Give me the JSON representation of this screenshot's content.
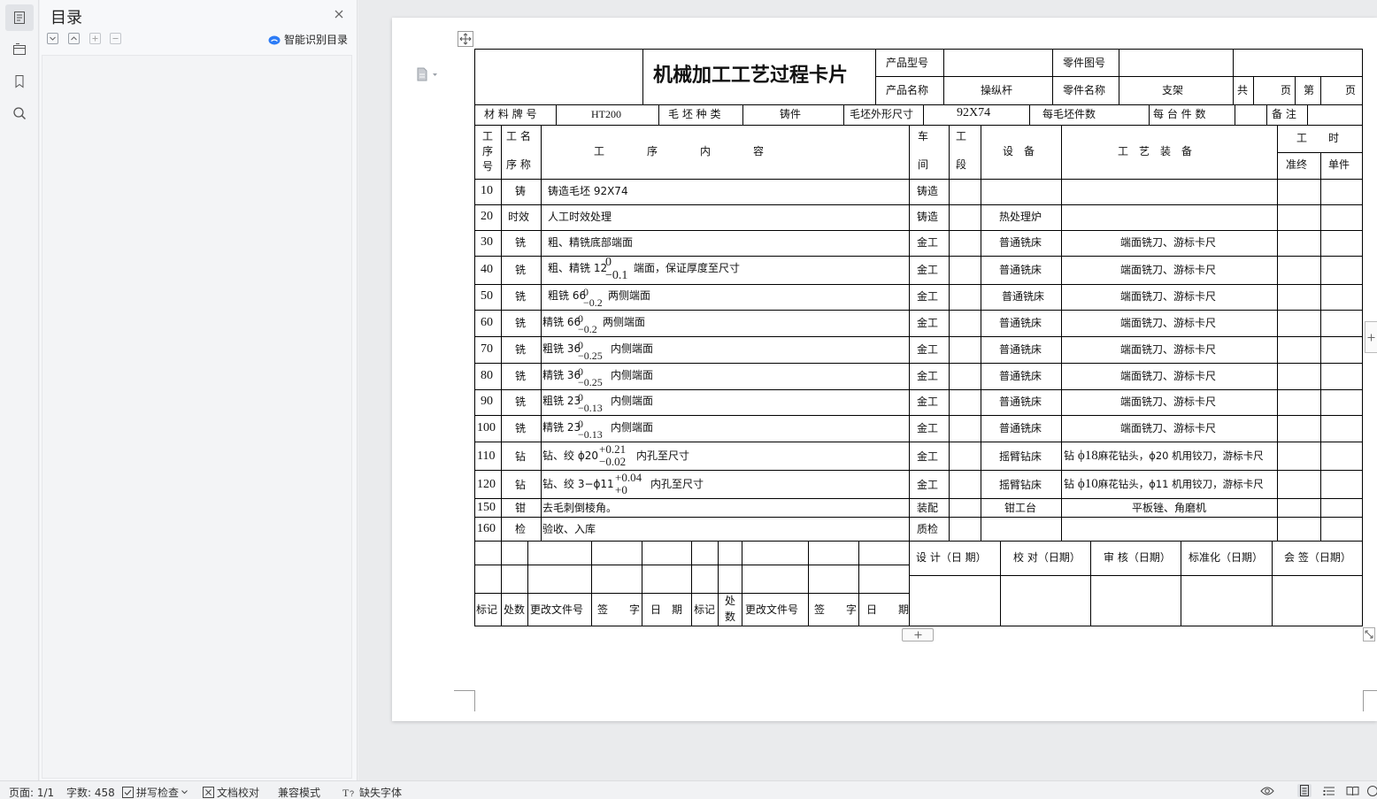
{
  "toc": {
    "title": "目录",
    "smart_label": "智能识别目录"
  },
  "card": {
    "title": "机械加工工艺过程卡片",
    "product_type_label": "产品型号",
    "part_drawing_label": "零件图号",
    "product_name_label": "产品名称",
    "product_name_value": "操纵杆",
    "part_name_label": "零件名称",
    "part_name_value": "支架",
    "total_label": "共",
    "page_label": "页",
    "sheet_label": "第",
    "page_label2": "页",
    "material_label": "材 料 牌 号",
    "material_value": "HT200",
    "blank_type_label": "毛 坯 种 类",
    "blank_type_value": "铸件",
    "blank_size_label": "毛坯外形尺寸",
    "blank_size_value": "92X74",
    "per_blank_label": "每毛坯件数",
    "per_unit_label": "每 台 件 数",
    "remark_label": "备 注",
    "col_no": [
      "工",
      "序",
      "号"
    ],
    "col_name": [
      "工 名",
      "序 称"
    ],
    "col_content": "工　　　　序　　　　内　　　　容",
    "col_workshop": [
      "车",
      "间"
    ],
    "col_section": [
      "工",
      "段"
    ],
    "col_equipment": "设　备",
    "col_tooling": "工　艺　装　备",
    "col_time": "工　　时",
    "col_prep": "准终",
    "col_unit": "单件"
  },
  "ops": [
    {
      "no": "10",
      "name": "铸",
      "content": "铸造毛坯 92X74",
      "shop": "铸造",
      "equip": "",
      "tool": ""
    },
    {
      "no": "20",
      "name": "时效",
      "content": "人工时效处理",
      "shop": "铸造",
      "equip": "热处理炉",
      "tool": ""
    },
    {
      "no": "30",
      "name": "铣",
      "content": "粗、精铣底部端面",
      "shop": "金工",
      "equip": "普通铣床",
      "tool": "端面铣刀、游标卡尺"
    },
    {
      "no": "40",
      "name": "铣",
      "content_pre": "粗、精铣 12",
      "tol_up": "0",
      "tol_dn": "−0.1",
      "content_post": "端面，保证厚度至尺寸",
      "shop": "金工",
      "equip": "普通铣床",
      "tool": "端面铣刀、游标卡尺"
    },
    {
      "no": "50",
      "name": "铣",
      "content_pre": "粗铣 66",
      "tol_up": "0",
      "tol_dn": "−0.2",
      "content_post": "两侧端面",
      "shop": "金工",
      "equip": "普通铣床",
      "tool": "端面铣刀、游标卡尺"
    },
    {
      "no": "60",
      "name": "铣",
      "content_pre": "精铣 66",
      "tol_up": "0",
      "tol_dn": "−0.2",
      "content_post": "两侧端面",
      "shop": "金工",
      "equip": "普通铣床",
      "tool": "端面铣刀、游标卡尺"
    },
    {
      "no": "70",
      "name": "铣",
      "content_pre": "粗铣 36",
      "tol_up": "0",
      "tol_dn": "−0.25",
      "content_post": "内侧端面",
      "shop": "金工",
      "equip": "普通铣床",
      "tool": "端面铣刀、游标卡尺"
    },
    {
      "no": "80",
      "name": "铣",
      "content_pre": "精铣 36",
      "tol_up": "0",
      "tol_dn": "−0.25",
      "content_post": "内侧端面",
      "shop": "金工",
      "equip": "普通铣床",
      "tool": "端面铣刀、游标卡尺"
    },
    {
      "no": "90",
      "name": "铣",
      "content_pre": "粗铣 23",
      "tol_up": "0",
      "tol_dn": "−0.13",
      "content_post": "内侧端面",
      "shop": "金工",
      "equip": "普通铣床",
      "tool": "端面铣刀、游标卡尺"
    },
    {
      "no": "100",
      "name": "铣",
      "content_pre": "精铣 23",
      "tol_up": "0",
      "tol_dn": "−0.13",
      "content_post": "内侧端面",
      "shop": "金工",
      "equip": "普通铣床",
      "tool": "端面铣刀、游标卡尺"
    },
    {
      "no": "110",
      "name": "钻",
      "content_pre": "钻、绞 ϕ20",
      "tol_up": "+0.21",
      "tol_dn": "−0.02",
      "content_post": "内孔至尺寸",
      "shop": "金工",
      "equip": "摇臂钻床",
      "tool_pre": "钻 ",
      "tool_phi": "ϕ18",
      "tool_post": "麻花钻头，ϕ20 机用铰刀，游标卡尺"
    },
    {
      "no": "120",
      "name": "钻",
      "content_pre": "钻、绞 3−ϕ11",
      "tol_up": "+0.04",
      "tol_dn": "+0",
      "content_post": "内孔至尺寸",
      "shop": "金工",
      "equip": "摇臂钻床",
      "tool_pre": "钻 ",
      "tool_phi": "ϕ10",
      "tool_post": "麻花钻头，ϕ11 机用铰刀，游标卡尺"
    },
    {
      "no": "150",
      "name": "钳",
      "content": "去毛刺倒棱角。",
      "shop": "装配",
      "equip": "钳工台",
      "tool": "平板锉、角磨机"
    },
    {
      "no": "160",
      "name": "检",
      "content": "验收、入库",
      "shop": "质检",
      "equip": "",
      "tool": ""
    }
  ],
  "footer": {
    "mark": "标记",
    "count": "处数",
    "doc": "更改文件号",
    "sign": "签　　字",
    "date": "日　期",
    "mark2": "标记",
    "count2": [
      "处",
      "数"
    ],
    "doc2": "更改文件号",
    "sign2": "签　　字",
    "date2": "日　　期",
    "design": "设 计（日 期）",
    "check": "校 对（日期）",
    "review": "审 核（日期）",
    "standard": "标准化（日期）",
    "approve": "会 签（日期）"
  },
  "status": {
    "page": "页面: 1/1",
    "words": "字数: 458",
    "spell": "拼写检查",
    "proof": "文档校对",
    "compat": "兼容模式",
    "missing_font": "缺失字体"
  }
}
